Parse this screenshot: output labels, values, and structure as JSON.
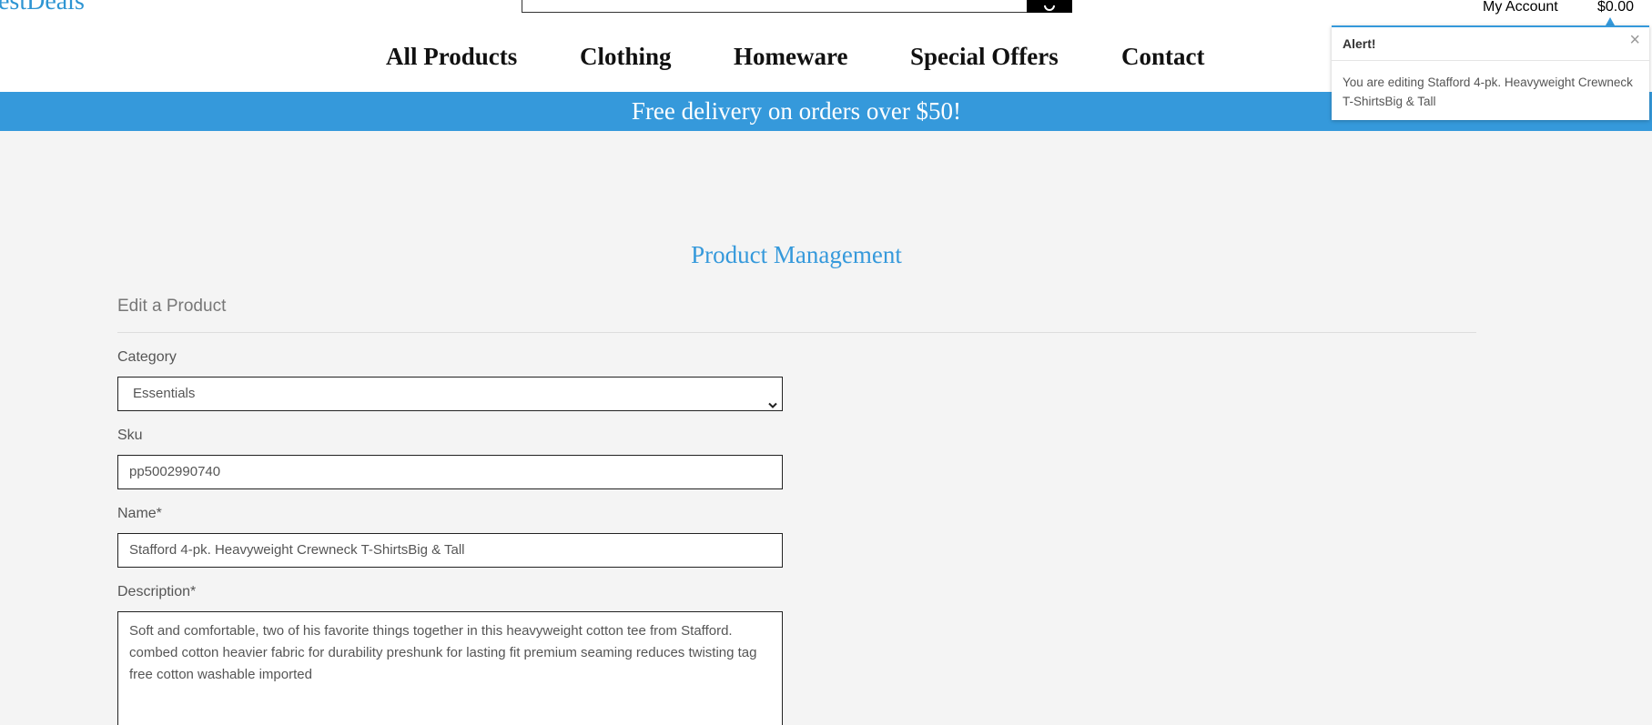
{
  "header": {
    "logo_text": "estDeals",
    "account_label": "My Account",
    "cart_total": "$0.00"
  },
  "nav": {
    "items": [
      {
        "label": "All Products"
      },
      {
        "label": "Clothing"
      },
      {
        "label": "Homeware"
      },
      {
        "label": "Special Offers"
      },
      {
        "label": "Contact"
      }
    ]
  },
  "promo": {
    "text": "Free delivery on orders over $50!"
  },
  "alert": {
    "title": "Alert!",
    "close_glyph": "×",
    "message": "You are editing Stafford 4-pk. Heavyweight Crewneck T-ShirtsBig & Tall"
  },
  "main": {
    "title": "Product Management",
    "section_title": "Edit a Product",
    "form": {
      "category_label": "Category",
      "category_value": "Essentials",
      "sku_label": "Sku",
      "sku_value": "pp5002990740",
      "name_label": "Name*",
      "name_value": "Stafford 4-pk. Heavyweight Crewneck T-ShirtsBig & Tall",
      "description_label": "Description*",
      "description_value": "Soft and comfortable, two of his favorite things together in this heavyweight cotton tee from Stafford.  combed cotton heavier fabric for durability preshunk for lasting fit premium seaming reduces twisting tag free cotton washable imported"
    }
  },
  "icons": {
    "search": "magnifier-icon",
    "close": "close-icon",
    "select": "chevron-down-icon"
  },
  "colors": {
    "accent": "#3599db",
    "banner_text": "#ffffff",
    "background": "#f4f4f4"
  }
}
